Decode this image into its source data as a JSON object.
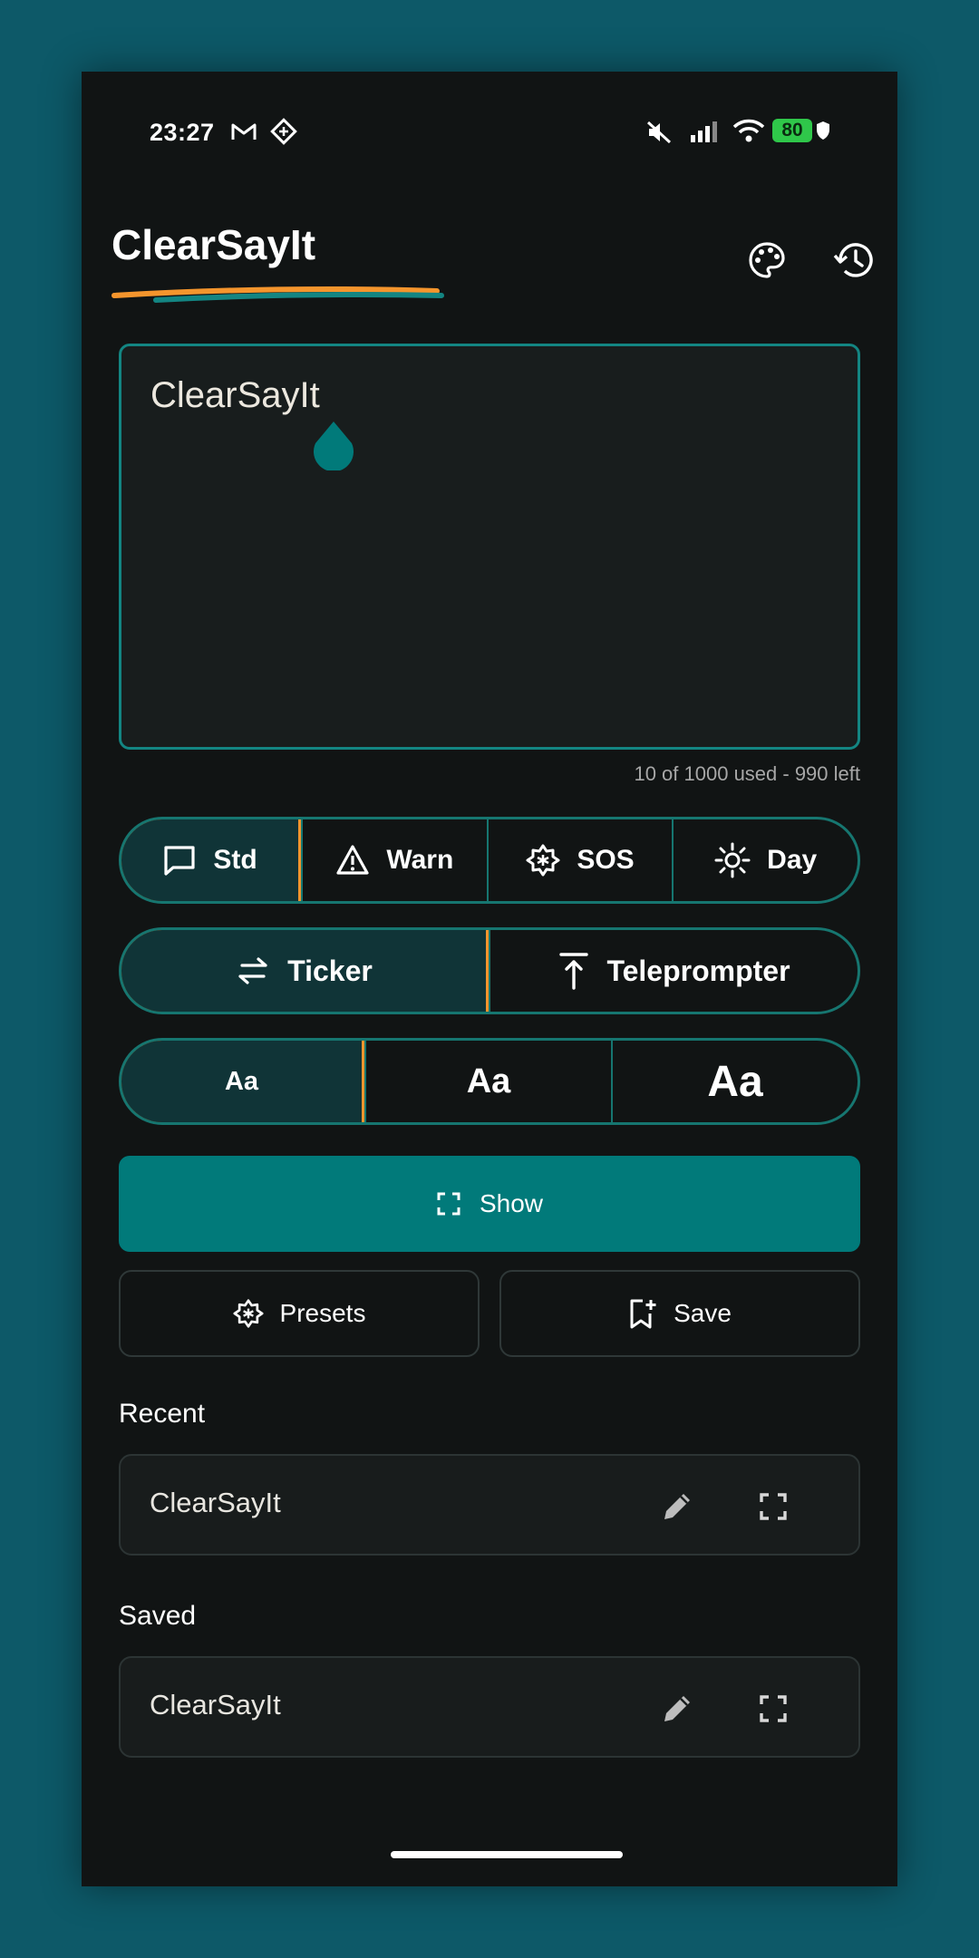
{
  "status": {
    "time": "23:27",
    "battery": "80"
  },
  "app": {
    "title": "ClearSayIt"
  },
  "editor": {
    "text": "ClearSayIt",
    "counter": "10 of 1000 used - 990 left"
  },
  "modes": [
    {
      "label": "Std",
      "icon": "message-square-icon",
      "selected": true
    },
    {
      "label": "Warn",
      "icon": "warning-triangle-icon",
      "selected": false
    },
    {
      "label": "SOS",
      "icon": "asterisk-badge-icon",
      "selected": false
    },
    {
      "label": "Day",
      "icon": "sun-icon",
      "selected": false
    }
  ],
  "display_types": [
    {
      "label": "Ticker",
      "icon": "swap-arrows-icon",
      "selected": true
    },
    {
      "label": "Teleprompter",
      "icon": "arrow-up-bar-icon",
      "selected": false
    }
  ],
  "text_sizes": [
    {
      "label": "Aa",
      "size": "small",
      "selected": true
    },
    {
      "label": "Aa",
      "size": "medium",
      "selected": false
    },
    {
      "label": "Aa",
      "size": "large",
      "selected": false
    }
  ],
  "actions": {
    "show": "Show",
    "presets": "Presets",
    "save": "Save"
  },
  "recent": {
    "heading": "Recent",
    "items": [
      "ClearSayIt"
    ]
  },
  "saved": {
    "heading": "Saved",
    "items": [
      "ClearSayIt"
    ]
  },
  "colors": {
    "accent": "#017a7a",
    "selected_border": "#f4952d",
    "background": "#111414",
    "frame": "#0d5968"
  }
}
